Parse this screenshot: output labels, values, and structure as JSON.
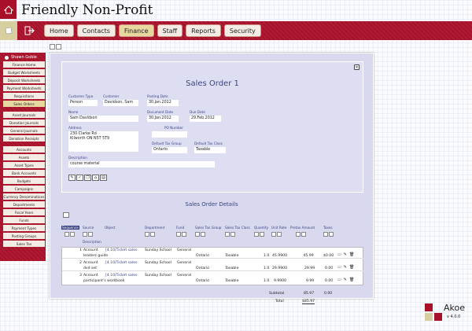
{
  "app": {
    "title": "Friendly Non-Profit"
  },
  "nav": [
    {
      "label": "Home",
      "active": false
    },
    {
      "label": "Contacts",
      "active": false
    },
    {
      "label": "Finance",
      "active": true
    },
    {
      "label": "Staff",
      "active": false
    },
    {
      "label": "Reports",
      "active": false
    },
    {
      "label": "Security",
      "active": false
    }
  ],
  "sidebar": {
    "user": "Shawn Goble",
    "groups": [
      [
        "Finance Home",
        "Budget Worksheets",
        "Deposit Worksheets",
        "Payment Worksheets",
        "Requisitions",
        "Sales Orders"
      ],
      [
        "Asset Journals",
        "Donation Journals",
        "General Journals",
        "Donation Receipts"
      ],
      [
        "Accounts",
        "Assets",
        "Asset Types",
        "Bank Accounts",
        "Budgets",
        "Campaigns",
        "Currency Denominations",
        "Departments",
        "Fiscal Years",
        "Funds",
        "Payment Types",
        "Posting Groups",
        "Sales Tax"
      ]
    ],
    "active": "Sales Orders"
  },
  "form": {
    "title": "Sales Order 1",
    "customer_type_label": "Customer Type",
    "customer_type": "Person",
    "customer_label": "Customer",
    "customer": "Davidson, Sam",
    "posting_date_label": "Posting Date",
    "posting_date": "30.Jan.2012",
    "name_label": "Name",
    "name": "Sam Davidson",
    "document_date_label": "Document Date",
    "document_date": "30.Jan.2012",
    "due_date_label": "Due Date",
    "due_date": "29.Feb.2012",
    "address_label": "Address",
    "address_line1": "230 Clarke Rd",
    "address_line2": "Kilworth ON  N5T 5T9",
    "po_number_label": "PO Number",
    "po_number": "",
    "default_tax_group_label": "Default Tax Group",
    "default_tax_group": "Ontario",
    "default_tax_class_label": "Default Tax Class",
    "default_tax_class": "Taxable",
    "description_label": "Description",
    "description": "course material",
    "toolbar_icons": [
      "edit-icon",
      "approve-icon",
      "copy-icon",
      "tag-icon",
      "print-icon"
    ]
  },
  "details": {
    "title": "Sales Order Details",
    "headers": {
      "sequence": "Sequence",
      "source": "Source",
      "object": "Object",
      "department": "Department",
      "fund": "Fund",
      "sales_tax_group": "Sales Tax Group",
      "sales_tax_class": "Sales Tax Class",
      "quantity": "Quantity",
      "unit_rate": "Unit Rate",
      "pretax_amount": "Pretax Amount",
      "taxes": "Taxes",
      "description": "Description"
    },
    "rows": [
      {
        "seq": "1",
        "source": "Account",
        "object": "[4.10/Ticket sales",
        "department": "Sunday School",
        "fund": "General",
        "description": "leaders guide",
        "tax_group": "Ontario",
        "tax_class": "Taxable",
        "quantity": "1.0",
        "unit_rate": "45.9900",
        "pretax": " 45.99",
        "taxes": "$0.00"
      },
      {
        "seq": "2",
        "source": "Account",
        "object": "[4.10/Ticket sales",
        "department": "Sunday School",
        "fund": "General",
        "description": "dvd set",
        "tax_group": "Ontario",
        "tax_class": "Taxable",
        "quantity": "1.0",
        "unit_rate": "29.9900",
        "pretax": "29.99",
        "taxes": "0.00"
      },
      {
        "seq": "3",
        "source": "Account",
        "object": "[4.10/Ticket sales",
        "department": "Sunday School",
        "fund": "General",
        "description": "participant's workbook",
        "tax_group": "Ontario",
        "tax_class": "Taxable",
        "quantity": "1.0",
        "unit_rate": "9.9900",
        "pretax": "9.99",
        "taxes": "0.00"
      }
    ],
    "subtotal_label": "Subtotal",
    "subtotal": "85.97",
    "subtotal_taxes": "0.00",
    "total_label": "Total",
    "total": "$85.97"
  },
  "brand": {
    "name": "Akoe",
    "version": "v 4.0.0",
    "colors": [
      "#a8102a",
      "#d8cfa0"
    ]
  }
}
